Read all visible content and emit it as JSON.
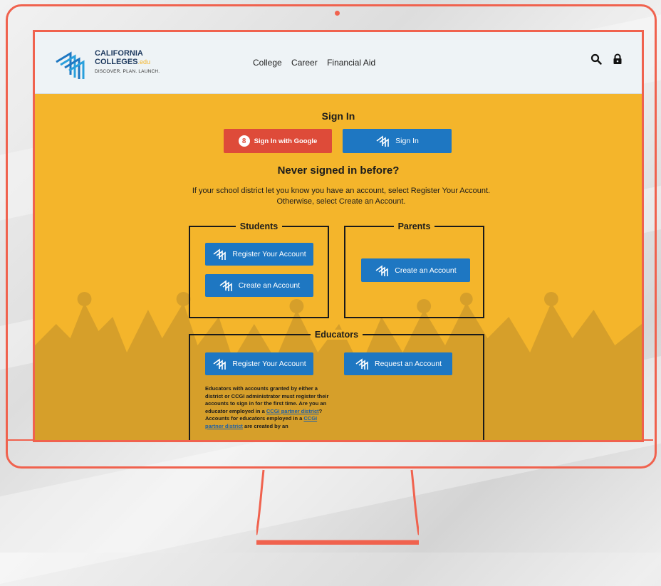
{
  "header": {
    "logo_line1": "CALIFORNIA",
    "logo_line2": "COLLEGES",
    "logo_edu": ".edu",
    "logo_tagline": "DISCOVER. PLAN. LAUNCH.",
    "nav": [
      "College",
      "Career",
      "Financial Aid"
    ],
    "icons": [
      "search-icon",
      "lock-icon"
    ]
  },
  "signin": {
    "title": "Sign In",
    "google_button": "Sign In with Google",
    "google_glyph": "8",
    "signin_button": "Sign In"
  },
  "never": {
    "title": "Never signed in before?",
    "intro": "If your school district let you know you have an account, select Register Your Account. Otherwise, select Create an Account."
  },
  "students": {
    "legend": "Students",
    "register_button": "Register Your Account",
    "create_button": "Create an Account"
  },
  "parents": {
    "legend": "Parents",
    "create_button": "Create an Account"
  },
  "educators": {
    "legend": "Educators",
    "register_button": "Register Your Account",
    "request_button": "Request an Account",
    "text_part1": "Educators with accounts granted by either a district or CCGI administrator must register their accounts to sign in for the first time. Are you an educator employed in a ",
    "link1": "CCGI partner district",
    "text_part2": "? Accounts for educators employed in a ",
    "link2": "CCGI partner district",
    "text_part3": " are created by an"
  },
  "colors": {
    "accent_orange": "#f0624e",
    "page_gold": "#f4b52b",
    "button_blue": "#1e77c2",
    "google_red": "#de4b39"
  }
}
